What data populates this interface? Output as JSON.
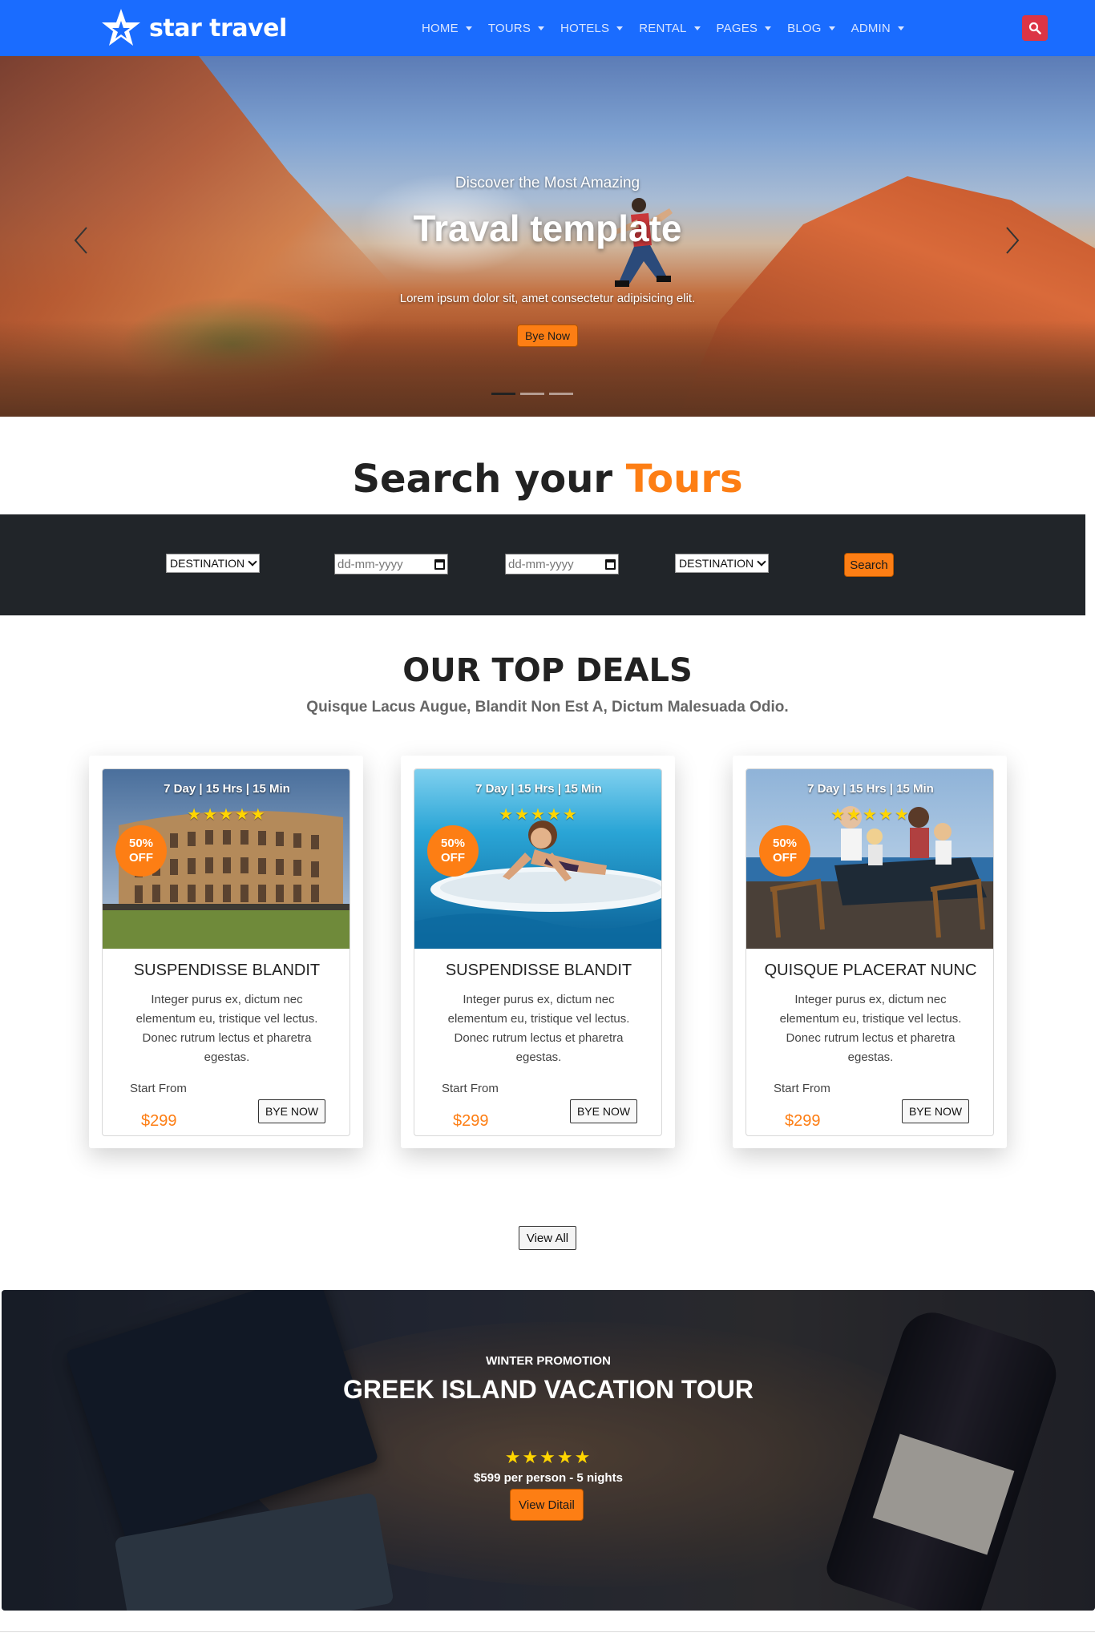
{
  "navbar": {
    "brand": "star travel",
    "brand_color": "#1a6cff",
    "menu": [
      {
        "label": "HOME"
      },
      {
        "label": "TOURS"
      },
      {
        "label": "HOTELS"
      },
      {
        "label": "RENTAL"
      },
      {
        "label": "PAGES"
      },
      {
        "label": "BLOG"
      },
      {
        "label": "ADMIN"
      }
    ],
    "search_icon": "search-icon"
  },
  "hero": {
    "pretitle": "Discover the Most Amazing",
    "title": "Traval template",
    "description": "Lorem ipsum dolor sit, amet consectetur adipisicing elit.",
    "button": "Bye Now",
    "slide_count": 3,
    "active_slide": 1
  },
  "search": {
    "heading_main": "Search your",
    "heading_accent": "Tours",
    "destination_from": "DESTINATION",
    "date_from_placeholder": "dd-mm-yyyy",
    "date_to_placeholder": "dd-mm-yyyy",
    "destination_to": "DESTINATION",
    "button": "Search"
  },
  "deals": {
    "title": "OUR TOP DEALS",
    "subtitle": "Quisque Lacus Augue, Blandit Non Est A, Dictum Malesuada Odio.",
    "items": [
      {
        "duration": "7 Day | 15 Hrs | 15 Min",
        "rating": 5,
        "badge_pct": "50%",
        "badge_off": "OFF",
        "name": "SUSPENDISSE BLANDIT",
        "description": "Integer purus ex, dictum nec elementum eu, tristique vel lectus. Donec rutrum lectus et pharetra egestas.",
        "start_label": "Start From",
        "price": "$299",
        "button": "BYE NOW"
      },
      {
        "duration": "7 Day | 15 Hrs | 15 Min",
        "rating": 5,
        "badge_pct": "50%",
        "badge_off": "OFF",
        "name": "SUSPENDISSE BLANDIT",
        "description": "Integer purus ex, dictum nec elementum eu, tristique vel lectus. Donec rutrum lectus et pharetra egestas.",
        "start_label": "Start From",
        "price": "$299",
        "button": "BYE NOW"
      },
      {
        "duration": "7 Day | 15 Hrs | 15 Min",
        "rating": 5,
        "badge_pct": "50%",
        "badge_off": "OFF",
        "name": "QUISQUE PLACERAT NUNC",
        "description": "Integer purus ex, dictum nec elementum eu, tristique vel lectus. Donec rutrum lectus et pharetra egestas.",
        "start_label": "Start From",
        "price": "$299",
        "button": "BYE NOW"
      }
    ],
    "view_all": "View All"
  },
  "promo": {
    "kicker": "WINTER PROMOTION",
    "title": "GREEK ISLAND VACATION TOUR",
    "rating": 5,
    "price_text": "$599 per person - 5 nights",
    "button": "View Ditail"
  },
  "colors": {
    "accent": "#fd7e14",
    "search_bar": "#212529",
    "search_button": "#dc3545",
    "star": "#ffd500"
  }
}
